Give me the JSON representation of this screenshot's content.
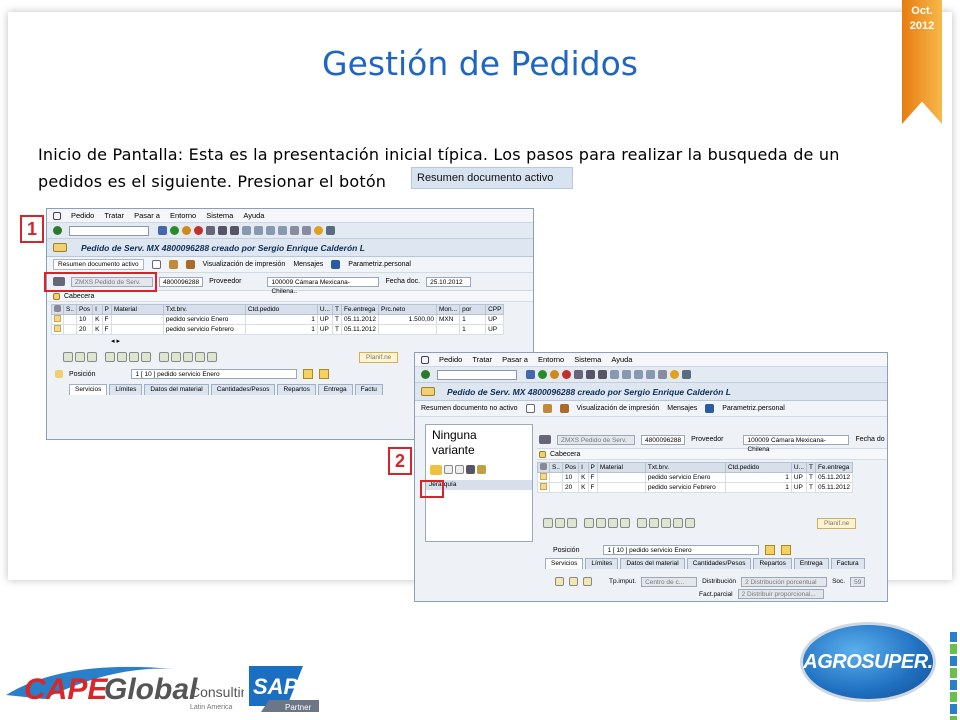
{
  "slide": {
    "title": "Gestión de Pedidos",
    "date_badge_line1": "Oct.",
    "date_badge_line2": "2012",
    "intro_line1": "Inicio de Pantalla: Esta es la presentación inicial típica. Los pasos para realizar la busqueda de un",
    "intro_line2": "pedidos es el siguiente. Presionar el botón",
    "intro_button": "Resumen documento activo"
  },
  "steps": {
    "step1": "1",
    "step2": "2"
  },
  "sap1": {
    "menu": [
      "Pedido",
      "Tratar",
      "Pasar a",
      "Entorno",
      "Sistema",
      "Ayuda"
    ],
    "title": "Pedido de Serv. MX 4800096288 creado por Sergio Enrique Calderón L",
    "app_buttons": {
      "resumen": "Resumen documento activo",
      "visualizacion": "Visualización de impresión",
      "mensajes": "Mensajes",
      "parametriz": "Parametriz.personal"
    },
    "header": {
      "doc_type": "ZMXS Pedido de Serv.",
      "doc_number": "4800096288",
      "proveedor_label": "Proveedor",
      "proveedor_value": "100009 Cámara Mexicana-Chilena..",
      "fecha_label": "Fecha doc.",
      "fecha_value": "25.10.2012"
    },
    "cabecera": "Cabecera",
    "columns": [
      "S..",
      "Pos",
      "I",
      "P",
      "Material",
      "Txt.brv.",
      "Ctd.pedido",
      "U...",
      "T",
      "Fe.entrega",
      "Prc.neto",
      "Mon...",
      "por",
      "CPP"
    ],
    "rows": [
      {
        "pos": "10",
        "i": "K",
        "p": "F",
        "material": "",
        "txt": "pedido servicio Enero",
        "ctd": "1",
        "u": "UP",
        "t": "T",
        "fe": "05.11.2012",
        "prc": "1.500,00",
        "mon": "MXN",
        "por": "1",
        "cpp": "UP"
      },
      {
        "pos": "20",
        "i": "K",
        "p": "F",
        "material": "",
        "txt": "pedido servicio Febrero",
        "ctd": "1",
        "u": "UP",
        "t": "T",
        "fe": "05.11.2012",
        "prc": "",
        "mon": "",
        "por": "1",
        "cpp": "UP"
      }
    ],
    "planif": "Planif.ne",
    "posicion_label": "Posición",
    "posicion_value": "1 [ 10 ] pedido servicio Enero",
    "tabs": [
      "Servicios",
      "Límites",
      "Datos del material",
      "Cantidades/Pesos",
      "Repartos",
      "Entrega",
      "Factu"
    ]
  },
  "sap2": {
    "menu": [
      "Pedido",
      "Tratar",
      "Pasar a",
      "Entorno",
      "Sistema",
      "Ayuda"
    ],
    "title": "Pedido de Serv. MX 4800096288 creado por Sergio Enrique Calderón L",
    "app_buttons": {
      "resumen": "Resumen documento no activo",
      "visualizacion": "Visualización de impresión",
      "mensajes": "Mensajes",
      "parametriz": "Parametriz.personal"
    },
    "left_panel": {
      "variant_line1": "Ninguna",
      "variant_line2": "variante",
      "jerarquia": "Jerarquía"
    },
    "header": {
      "doc_type": "ZMXS Pedido de Serv.",
      "doc_number": "4800096288",
      "proveedor_label": "Proveedor",
      "proveedor_value": "100009 Cámara Mexicana-Chilena",
      "fecha_label": "Fecha do"
    },
    "cabecera": "Cabecera",
    "columns": [
      "S..",
      "Pos",
      "I",
      "P",
      "Material",
      "Txt.brv.",
      "Ctd.pedido",
      "U...",
      "T",
      "Fe.entrega"
    ],
    "rows": [
      {
        "pos": "10",
        "i": "K",
        "p": "F",
        "material": "",
        "txt": "pedido servicio Enero",
        "ctd": "1",
        "u": "UP",
        "t": "T",
        "fe": "05.11.2012"
      },
      {
        "pos": "20",
        "i": "K",
        "p": "F",
        "material": "",
        "txt": "pedido servicio Febrero",
        "ctd": "1",
        "u": "UP",
        "t": "T",
        "fe": "05.11.2012"
      }
    ],
    "planif": "Planif.ne",
    "posicion_label": "Posición",
    "posicion_value": "1 [ 10 ] pedido servicio Enero",
    "tabs": [
      "Servicios",
      "Límites",
      "Datos del material",
      "Cantidades/Pesos",
      "Repartos",
      "Entrega",
      "Factura"
    ],
    "tpimput_label": "Tp.imput.",
    "tpimput_value": "Centro de c...",
    "distribucion_label": "Distribución",
    "distribucion_value": "2 Distribución porcentual",
    "soc_label": "Soc.",
    "soc_value": "59",
    "factparcial_label": "Fact.parcial",
    "factparcial_value": "2 Distribuir proporcional..."
  },
  "logos": {
    "cape_word1": "CAPE",
    "cape_word2": "Global",
    "cape_word3": "Consulting",
    "cape_sub": "Latin America",
    "sap_word": "SAP",
    "sap_partner": "Partner",
    "agro": "AGROSUPER."
  },
  "colors": {
    "title": "#1f66c2",
    "highlight": "#d9232a",
    "ribbon": "#f0a030"
  }
}
